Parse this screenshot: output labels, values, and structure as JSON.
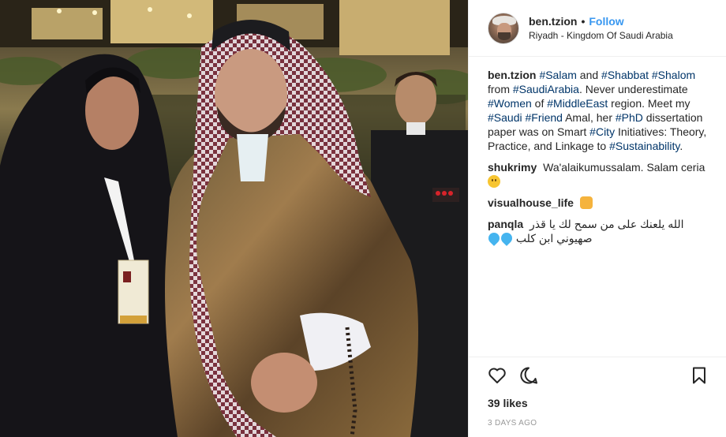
{
  "post": {
    "username": "ben.tzion",
    "separator": "•",
    "follow_label": "Follow",
    "location": "Riyadh - Kingdom Of Saudi Arabia"
  },
  "caption": {
    "username": "ben.tzion",
    "segments": [
      {
        "text": "#Salam",
        "tag": true
      },
      {
        "text": " and ",
        "tag": false
      },
      {
        "text": "#Shabbat",
        "tag": true
      },
      {
        "text": " ",
        "tag": false
      },
      {
        "text": "#Shalom",
        "tag": true
      },
      {
        "text": " from ",
        "tag": false
      },
      {
        "text": "#SaudiArabia",
        "tag": true
      },
      {
        "text": ". Never underestimate ",
        "tag": false
      },
      {
        "text": "#Women",
        "tag": true
      },
      {
        "text": " of ",
        "tag": false
      },
      {
        "text": "#MiddleEast",
        "tag": true
      },
      {
        "text": " region. Meet my ",
        "tag": false
      },
      {
        "text": "#Saudi",
        "tag": true
      },
      {
        "text": " ",
        "tag": false
      },
      {
        "text": "#Friend",
        "tag": true
      },
      {
        "text": " Amal, her ",
        "tag": false
      },
      {
        "text": "#PhD",
        "tag": true
      },
      {
        "text": " dissertation paper was on Smart ",
        "tag": false
      },
      {
        "text": "#City",
        "tag": true
      },
      {
        "text": " Initiatives: Theory, Practice, and Linkage to ",
        "tag": false
      },
      {
        "text": "#Sustainability",
        "tag": true
      },
      {
        "text": ".",
        "tag": false
      }
    ]
  },
  "comments": [
    {
      "username": "shukrimy",
      "text": "Wa'alaikumussalam. Salam ceria",
      "emoji": "smile-emoji"
    },
    {
      "username": "visualhouse_life",
      "text": "",
      "emoji": "raising-hands-emoji"
    },
    {
      "username": "panqla",
      "text": "الله يلعنك على من سمح لك يا قذر",
      "text2": "صهيوني ابن كلب",
      "emoji": "sweat-drops-emoji"
    }
  ],
  "actions": {
    "like_icon": "heart-icon",
    "comment_icon": "comment-icon",
    "save_icon": "bookmark-icon",
    "likes_text": "39 likes",
    "time_ago": "3 DAYS AGO"
  },
  "photo": {
    "badge_logo": "MISK"
  },
  "colors": {
    "link": "#3897f0",
    "hashtag": "#003569",
    "text": "#262626",
    "muted": "#999999",
    "border": "#efefef"
  }
}
